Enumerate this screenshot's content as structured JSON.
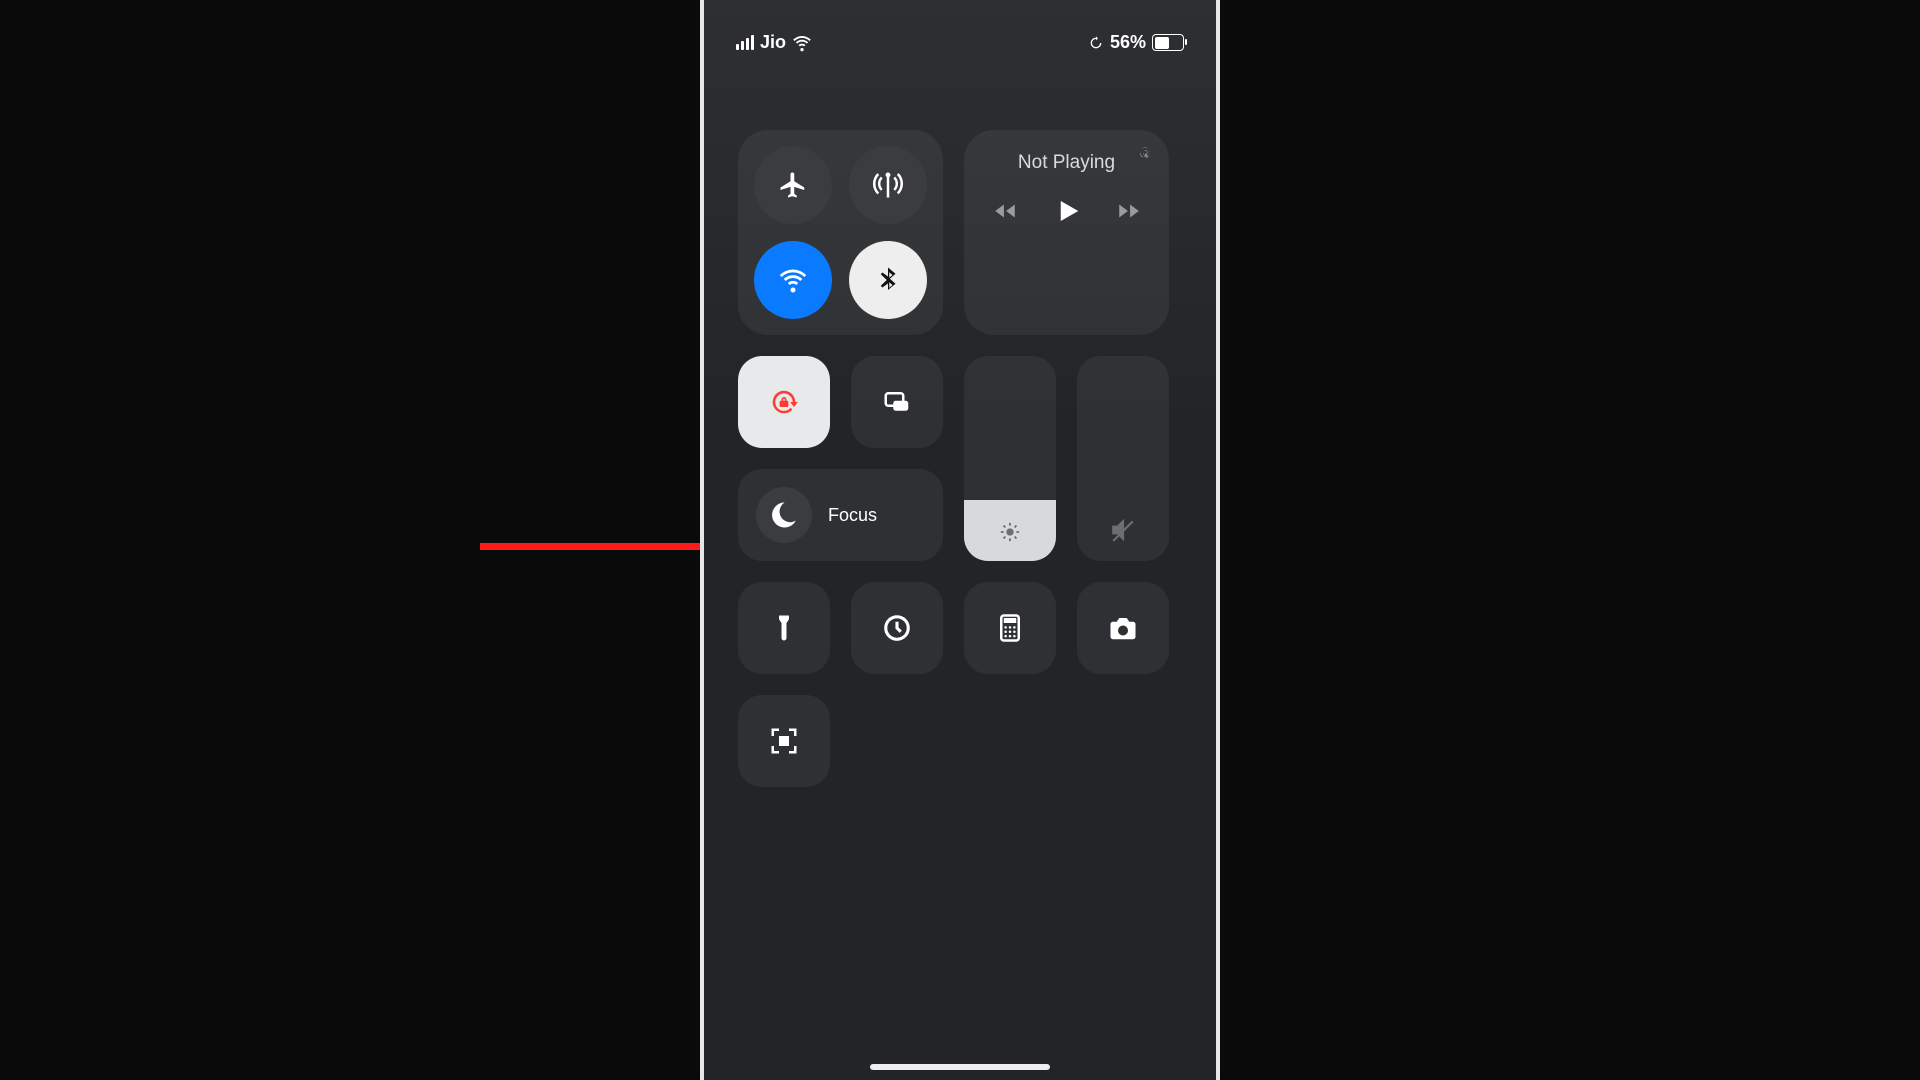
{
  "status": {
    "carrier": "Jio",
    "battery_pct": "56%",
    "battery_fill_pct": 56
  },
  "media": {
    "now_playing": "Not Playing"
  },
  "focus": {
    "label": "Focus"
  },
  "brightness": {
    "level_pct": 30
  },
  "volume": {
    "level_pct": 0,
    "muted": true
  }
}
